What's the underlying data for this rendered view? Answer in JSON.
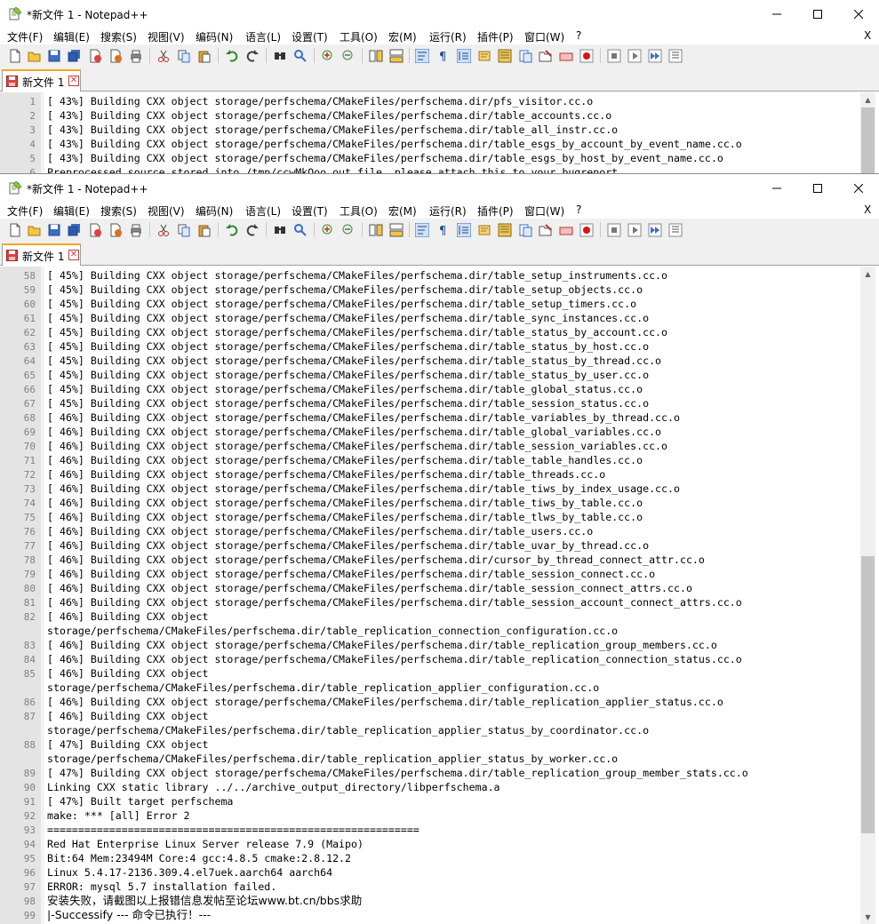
{
  "app": {
    "title": "*新文件 1 - Notepad++",
    "menu": [
      "文件(F)",
      "编辑(E)",
      "搜索(S)",
      "视图(V)",
      "编码(N)",
      "语言(L)",
      "设置(T)",
      "工具(O)",
      "宏(M)",
      "运行(R)",
      "插件(P)",
      "窗口(W)",
      "?"
    ],
    "menu_close": "X",
    "tab_label": "新文件 1",
    "tab_close": "✕",
    "window_controls": {
      "minimize": "—",
      "maximize": "☐",
      "close": "✕"
    }
  },
  "colors": {
    "accent_tab": "#f5a623",
    "gutter": "#e4e4e4",
    "toolbar": "#f0f0f0"
  },
  "icons": [
    "new-file-icon",
    "open-file-icon",
    "save-icon",
    "save-all-icon",
    "close-icon",
    "close-all-icon",
    "print-icon",
    "cut-icon",
    "copy-icon",
    "paste-icon",
    "undo-icon",
    "redo-icon",
    "find-icon",
    "replace-icon",
    "zoom-in-icon",
    "zoom-out-icon",
    "sync-v-icon",
    "sync-h-icon",
    "word-wrap-icon",
    "show-all-chars-icon",
    "indent-guide-icon",
    "udl-icon",
    "doc-map-icon",
    "function-list-icon",
    "folder-workspace-icon",
    "monitoring-icon",
    "record-macro-icon",
    "stop-record-icon",
    "playback-macro-icon",
    "run-macro-multiple-icon",
    "save-macro-icon"
  ],
  "top_editor": {
    "lines": [
      {
        "n": "1",
        "text": "[ 43%] Building CXX object storage/perfschema/CMakeFiles/perfschema.dir/pfs_visitor.cc.o"
      },
      {
        "n": "2",
        "text": "[ 43%] Building CXX object storage/perfschema/CMakeFiles/perfschema.dir/table_accounts.cc.o"
      },
      {
        "n": "3",
        "text": "[ 43%] Building CXX object storage/perfschema/CMakeFiles/perfschema.dir/table_all_instr.cc.o"
      },
      {
        "n": "4",
        "text": "[ 43%] Building CXX object storage/perfschema/CMakeFiles/perfschema.dir/table_esgs_by_account_by_event_name.cc.o"
      },
      {
        "n": "5",
        "text": "[ 43%] Building CXX object storage/perfschema/CMakeFiles/perfschema.dir/table_esgs_by_host_by_event_name.cc.o"
      },
      {
        "n": "6",
        "text": "Preprocessed source stored into /tmp/ccwMkOoo.out file, please attach this to your bugreport."
      }
    ]
  },
  "bottom_editor": {
    "lines": [
      {
        "n": "58",
        "text": "[ 45%] Building CXX object storage/perfschema/CMakeFiles/perfschema.dir/table_setup_instruments.cc.o"
      },
      {
        "n": "59",
        "text": "[ 45%] Building CXX object storage/perfschema/CMakeFiles/perfschema.dir/table_setup_objects.cc.o"
      },
      {
        "n": "60",
        "text": "[ 45%] Building CXX object storage/perfschema/CMakeFiles/perfschema.dir/table_setup_timers.cc.o"
      },
      {
        "n": "61",
        "text": "[ 45%] Building CXX object storage/perfschema/CMakeFiles/perfschema.dir/table_sync_instances.cc.o"
      },
      {
        "n": "62",
        "text": "[ 45%] Building CXX object storage/perfschema/CMakeFiles/perfschema.dir/table_status_by_account.cc.o"
      },
      {
        "n": "63",
        "text": "[ 45%] Building CXX object storage/perfschema/CMakeFiles/perfschema.dir/table_status_by_host.cc.o"
      },
      {
        "n": "64",
        "text": "[ 45%] Building CXX object storage/perfschema/CMakeFiles/perfschema.dir/table_status_by_thread.cc.o"
      },
      {
        "n": "65",
        "text": "[ 45%] Building CXX object storage/perfschema/CMakeFiles/perfschema.dir/table_status_by_user.cc.o"
      },
      {
        "n": "66",
        "text": "[ 45%] Building CXX object storage/perfschema/CMakeFiles/perfschema.dir/table_global_status.cc.o"
      },
      {
        "n": "67",
        "text": "[ 45%] Building CXX object storage/perfschema/CMakeFiles/perfschema.dir/table_session_status.cc.o"
      },
      {
        "n": "68",
        "text": "[ 46%] Building CXX object storage/perfschema/CMakeFiles/perfschema.dir/table_variables_by_thread.cc.o"
      },
      {
        "n": "69",
        "text": "[ 46%] Building CXX object storage/perfschema/CMakeFiles/perfschema.dir/table_global_variables.cc.o"
      },
      {
        "n": "70",
        "text": "[ 46%] Building CXX object storage/perfschema/CMakeFiles/perfschema.dir/table_session_variables.cc.o"
      },
      {
        "n": "71",
        "text": "[ 46%] Building CXX object storage/perfschema/CMakeFiles/perfschema.dir/table_table_handles.cc.o"
      },
      {
        "n": "72",
        "text": "[ 46%] Building CXX object storage/perfschema/CMakeFiles/perfschema.dir/table_threads.cc.o"
      },
      {
        "n": "73",
        "text": "[ 46%] Building CXX object storage/perfschema/CMakeFiles/perfschema.dir/table_tiws_by_index_usage.cc.o"
      },
      {
        "n": "74",
        "text": "[ 46%] Building CXX object storage/perfschema/CMakeFiles/perfschema.dir/table_tiws_by_table.cc.o"
      },
      {
        "n": "75",
        "text": "[ 46%] Building CXX object storage/perfschema/CMakeFiles/perfschema.dir/table_tlws_by_table.cc.o"
      },
      {
        "n": "76",
        "text": "[ 46%] Building CXX object storage/perfschema/CMakeFiles/perfschema.dir/table_users.cc.o"
      },
      {
        "n": "77",
        "text": "[ 46%] Building CXX object storage/perfschema/CMakeFiles/perfschema.dir/table_uvar_by_thread.cc.o"
      },
      {
        "n": "78",
        "text": "[ 46%] Building CXX object storage/perfschema/CMakeFiles/perfschema.dir/cursor_by_thread_connect_attr.cc.o"
      },
      {
        "n": "79",
        "text": "[ 46%] Building CXX object storage/perfschema/CMakeFiles/perfschema.dir/table_session_connect.cc.o"
      },
      {
        "n": "80",
        "text": "[ 46%] Building CXX object storage/perfschema/CMakeFiles/perfschema.dir/table_session_connect_attrs.cc.o"
      },
      {
        "n": "81",
        "text": "[ 46%] Building CXX object storage/perfschema/CMakeFiles/perfschema.dir/table_session_account_connect_attrs.cc.o"
      },
      {
        "n": "82",
        "text": "[ 46%] Building CXX object"
      },
      {
        "n": "",
        "text": "storage/perfschema/CMakeFiles/perfschema.dir/table_replication_connection_configuration.cc.o"
      },
      {
        "n": "83",
        "text": "[ 46%] Building CXX object storage/perfschema/CMakeFiles/perfschema.dir/table_replication_group_members.cc.o"
      },
      {
        "n": "84",
        "text": "[ 46%] Building CXX object storage/perfschema/CMakeFiles/perfschema.dir/table_replication_connection_status.cc.o"
      },
      {
        "n": "85",
        "text": "[ 46%] Building CXX object"
      },
      {
        "n": "",
        "text": "storage/perfschema/CMakeFiles/perfschema.dir/table_replication_applier_configuration.cc.o"
      },
      {
        "n": "86",
        "text": "[ 46%] Building CXX object storage/perfschema/CMakeFiles/perfschema.dir/table_replication_applier_status.cc.o"
      },
      {
        "n": "87",
        "text": "[ 46%] Building CXX object"
      },
      {
        "n": "",
        "text": "storage/perfschema/CMakeFiles/perfschema.dir/table_replication_applier_status_by_coordinator.cc.o"
      },
      {
        "n": "88",
        "text": "[ 47%] Building CXX object"
      },
      {
        "n": "",
        "text": "storage/perfschema/CMakeFiles/perfschema.dir/table_replication_applier_status_by_worker.cc.o"
      },
      {
        "n": "89",
        "text": "[ 47%] Building CXX object storage/perfschema/CMakeFiles/perfschema.dir/table_replication_group_member_stats.cc.o"
      },
      {
        "n": "90",
        "text": "Linking CXX static library ../../archive_output_directory/libperfschema.a"
      },
      {
        "n": "91",
        "text": "[ 47%] Built target perfschema"
      },
      {
        "n": "92",
        "text": "make: *** [all] Error 2"
      },
      {
        "n": "93",
        "text": "============================================================"
      },
      {
        "n": "94",
        "text": "Red Hat Enterprise Linux Server release 7.9 (Maipo)"
      },
      {
        "n": "95",
        "text": "Bit:64 Mem:23494M Core:4 gcc:4.8.5 cmake:2.8.12.2"
      },
      {
        "n": "96",
        "text": "Linux 5.4.17-2136.309.4.el7uek.aarch64 aarch64"
      },
      {
        "n": "97",
        "text": "ERROR: mysql 5.7 installation failed."
      },
      {
        "n": "98",
        "text": "安装失败，请截图以上报错信息发帖至论坛www.bt.cn/bbs求助",
        "cjk": true
      },
      {
        "n": "99",
        "text": "|-Successify --- 命令已执行！---",
        "cjk": true
      }
    ]
  }
}
